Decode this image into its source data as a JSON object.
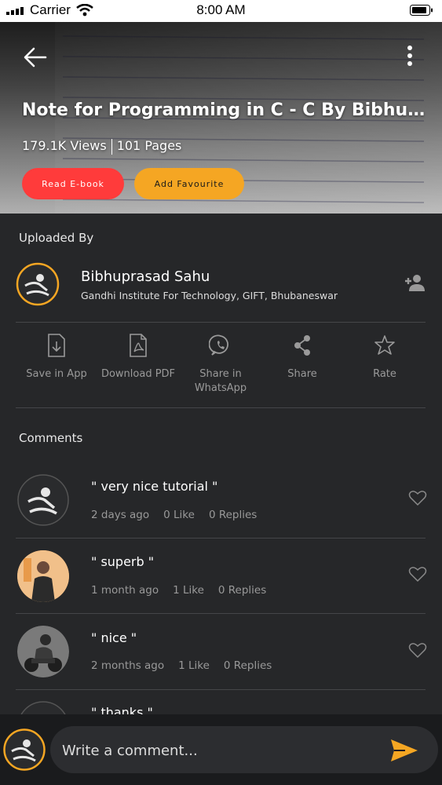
{
  "status_bar": {
    "carrier": "Carrier",
    "time": "8:00 AM"
  },
  "header": {
    "title": "Note for Programming in C - C By Bibhuprasad...",
    "views": "179.1K Views",
    "pages": "101 Pages",
    "read_button": "Read E-book",
    "favourite_button": "Add Favourite"
  },
  "uploader": {
    "section_label": "Uploaded By",
    "name": "Bibhuprasad Sahu",
    "institute": "Gandhi Institute For Technology, GIFT, Bhubaneswar"
  },
  "actions": [
    {
      "label": "Save in App",
      "icon": "download-file-icon"
    },
    {
      "label": "Download PDF",
      "icon": "pdf-icon"
    },
    {
      "label": "Share in WhatsApp",
      "icon": "whatsapp-icon"
    },
    {
      "label": "Share",
      "icon": "share-icon"
    },
    {
      "label": "Rate",
      "icon": "star-icon"
    }
  ],
  "comments": {
    "section_label": "Comments",
    "items": [
      {
        "text": "\" very nice tutorial  \"",
        "time": "2 days ago",
        "likes": "0 Like",
        "replies": "0 Replies"
      },
      {
        "text": "\" superb \"",
        "time": "1 month ago",
        "likes": "1 Like",
        "replies": "0 Replies"
      },
      {
        "text": "\" nice \"",
        "time": "2 months ago",
        "likes": "1 Like",
        "replies": "0 Replies"
      },
      {
        "text": "\" thanks \"",
        "time": "",
        "likes": "",
        "replies": ""
      }
    ]
  },
  "composer": {
    "placeholder": "Write a comment..."
  },
  "colors": {
    "read": "#ff3b3b",
    "favourite": "#f5a623",
    "send": "#f5a623",
    "background": "#262729"
  }
}
